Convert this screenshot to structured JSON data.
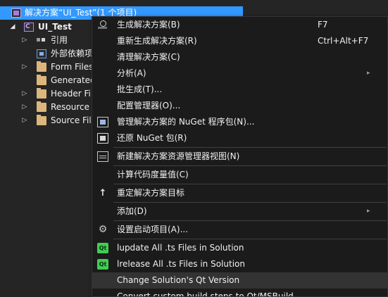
{
  "tree": {
    "solution_label": "解决方案“UI_Test”(1 个项目)",
    "project_label": "UI_Test",
    "items": [
      {
        "label": "引用",
        "icon": "references-icon"
      },
      {
        "label": "外部依赖项",
        "icon": "external-dependencies-icon"
      },
      {
        "label": "Form Files",
        "icon": "folder-icon"
      },
      {
        "label": "Generated",
        "icon": "folder-icon"
      },
      {
        "label": "Header Fi",
        "icon": "folder-icon"
      },
      {
        "label": "Resource",
        "icon": "folder-icon"
      },
      {
        "label": "Source Fil",
        "icon": "folder-icon"
      }
    ]
  },
  "menu": {
    "items": [
      {
        "label": "生成解决方案(B)",
        "shortcut": "F7",
        "icon": "build-icon"
      },
      {
        "label": "重新生成解决方案(R)",
        "shortcut": "Ctrl+Alt+F7"
      },
      {
        "label": "清理解决方案(C)"
      },
      {
        "label": "分析(A)",
        "submenu": true
      },
      {
        "label": "批生成(T)..."
      },
      {
        "label": "配置管理器(O)..."
      },
      {
        "label": "管理解决方案的 NuGet 程序包(N)...",
        "icon": "nuget-package-icon"
      },
      {
        "label": "还原 NuGet 包(R)",
        "icon": "nuget-restore-icon"
      },
      {
        "label": "新建解决方案资源管理器视图(N)",
        "icon": "new-view-icon"
      },
      {
        "label": "计算代码度量值(C)"
      },
      {
        "label": "重定解决方案目标",
        "icon": "retarget-arrow-icon"
      },
      {
        "label": "添加(D)",
        "submenu": true
      },
      {
        "label": "设置启动项目(A)...",
        "icon": "gear-icon"
      },
      {
        "label": "lupdate All .ts Files in Solution",
        "icon": "qt-icon"
      },
      {
        "label": "lrelease All .ts Files in Solution",
        "icon": "qt-icon"
      },
      {
        "label": "Change Solution's Qt Version"
      },
      {
        "label": "Convert custom build steps to Qt/MSBuild"
      }
    ],
    "qt_badge": "Qt",
    "submenu_glyph": "▸",
    "gear_glyph": "⚙",
    "up_glyph": "↑"
  },
  "colors": {
    "selection": "#3399ff",
    "menu_background": "#1b1b1c",
    "highlight": "#333334",
    "qt_green": "#41cd52"
  }
}
